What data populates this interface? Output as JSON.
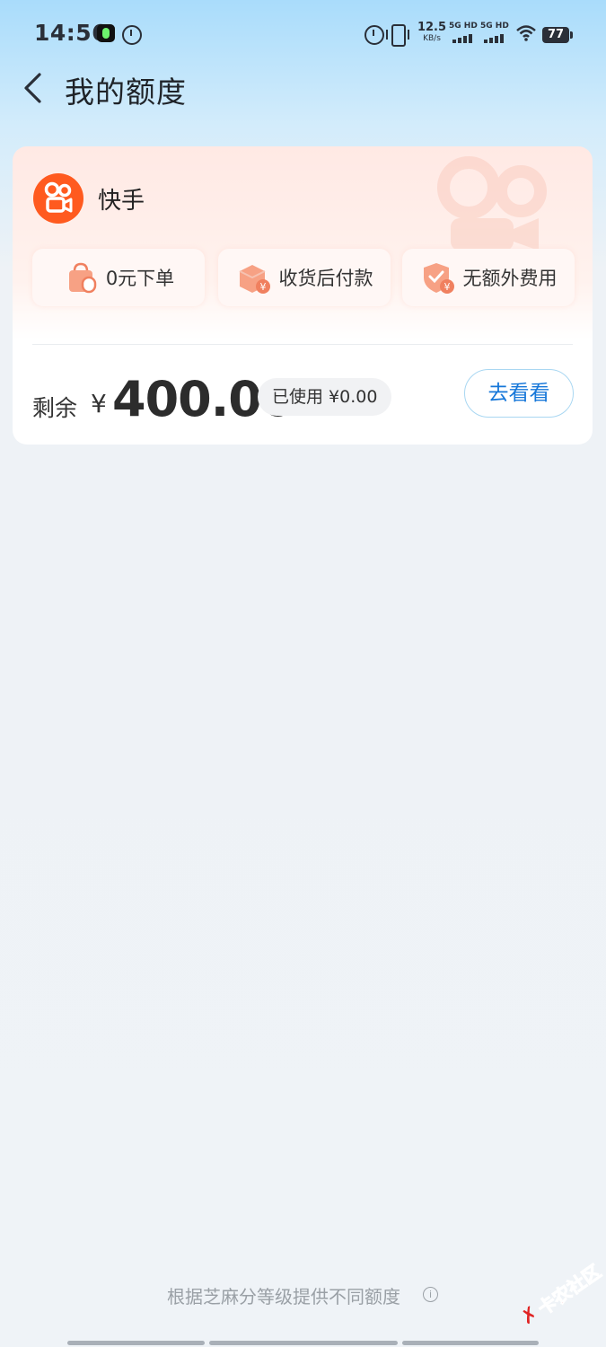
{
  "status_bar": {
    "time": "14:56",
    "net_speed_value": "12.5",
    "net_speed_unit": "KB/s",
    "sim1_label": "5G HD",
    "sim2_label": "5G HD",
    "battery": "77"
  },
  "header": {
    "title": "我的额度"
  },
  "card": {
    "brand_name": "快手",
    "features": [
      {
        "label": "0元下单",
        "icon": "shopping-bag-icon"
      },
      {
        "label": "收货后付款",
        "icon": "package-yuan-icon"
      },
      {
        "label": "无额外费用",
        "icon": "shield-check-yuan-icon"
      }
    ],
    "remain_label": "剩余",
    "currency": "¥",
    "amount": "400.00",
    "used_text": "已使用 ¥0.00",
    "go_button_label": "去看看"
  },
  "footer": {
    "note": "根据芝麻分等级提供不同额度",
    "info_symbol": "i",
    "watermark_x": "✗",
    "watermark_text": "卡农社区"
  },
  "colors": {
    "brand_orange": "#ff5a1f",
    "button_blue": "#1677d9"
  }
}
